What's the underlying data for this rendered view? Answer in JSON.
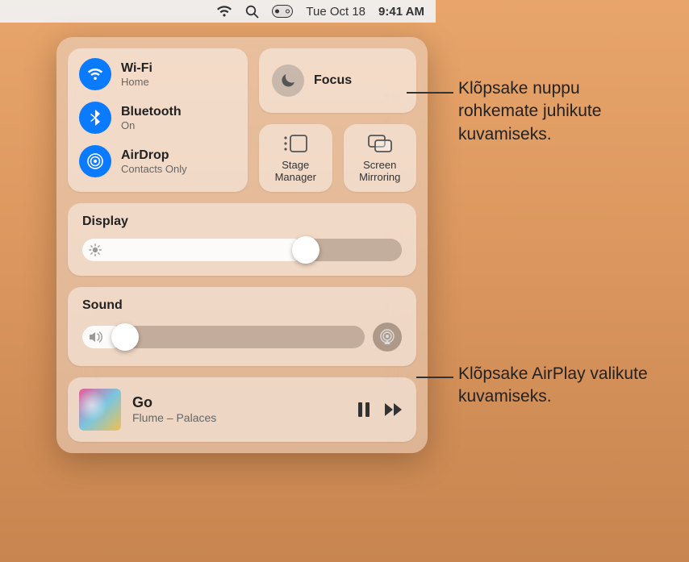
{
  "menubar": {
    "date": "Tue Oct 18",
    "time": "9:41 AM"
  },
  "connectivity": {
    "wifi": {
      "title": "Wi-Fi",
      "sub": "Home"
    },
    "bluetooth": {
      "title": "Bluetooth",
      "sub": "On"
    },
    "airdrop": {
      "title": "AirDrop",
      "sub": "Contacts Only"
    }
  },
  "focus": {
    "label": "Focus"
  },
  "stage_manager": {
    "label": "Stage Manager"
  },
  "screen_mirroring": {
    "label": "Screen Mirroring"
  },
  "display": {
    "title": "Display",
    "value_pct": 70
  },
  "sound": {
    "title": "Sound",
    "value_pct": 15
  },
  "now_playing": {
    "title": "Go",
    "subtitle": "Flume – Palaces"
  },
  "callouts": {
    "focus": "Klõpsake nuppu rohkemate juhikute kuvamiseks.",
    "airplay": "Klõpsake AirPlay valikute kuvamiseks."
  }
}
